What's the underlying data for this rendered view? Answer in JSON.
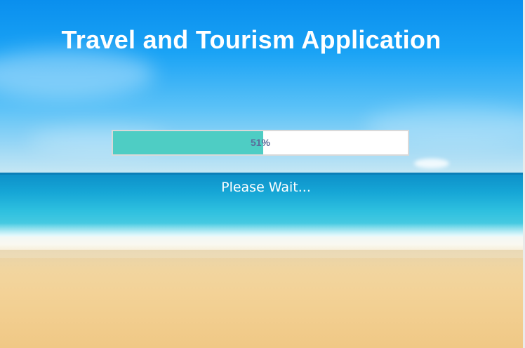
{
  "window": {
    "title": "Travel and Tourism Application"
  },
  "loader": {
    "progress_percent": 51,
    "progress_label": "51%",
    "status_text": "Please Wait..."
  },
  "colors": {
    "progress_fill": "#4ecdc4",
    "progress_track": "#ffffff",
    "progress_text": "#5a6c9a",
    "title_text": "#ffffff"
  }
}
